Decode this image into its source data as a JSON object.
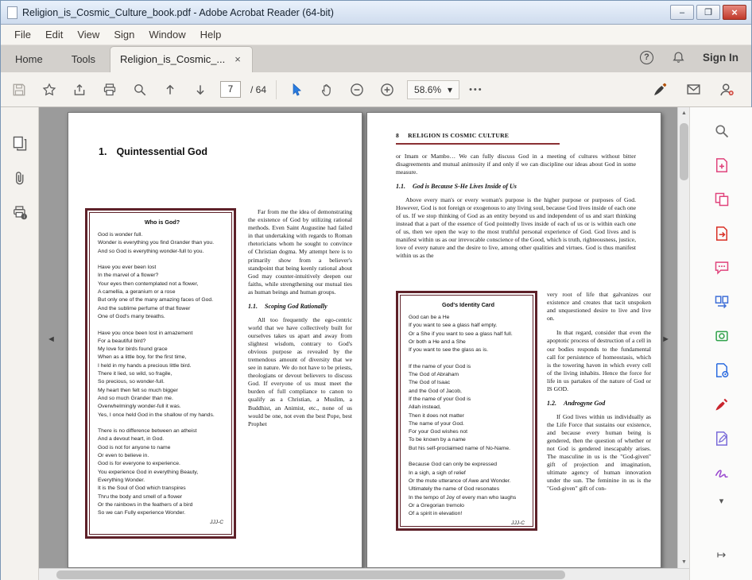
{
  "window": {
    "title": "Religion_is_Cosmic_Culture_book.pdf - Adobe Acrobat Reader (64-bit)"
  },
  "icons": {
    "minimize": "–",
    "maximize": "❐",
    "close": "×",
    "tab_close": "×",
    "help": "?",
    "caret_down": "▾",
    "ellipsis": "•••",
    "nav_left": "◄",
    "nav_right": "►",
    "scroll_up": "▲",
    "scroll_down": "▼",
    "pane_expand": "↦"
  },
  "colors": {
    "accent_blue": "#2a7de1",
    "close_button_red": "#c0392b",
    "poem_box_border": "#5e2129",
    "header_rule_maroon": "#8a3033",
    "document_background": "#9b9b9b"
  },
  "menu": {
    "items": [
      "File",
      "Edit",
      "View",
      "Sign",
      "Window",
      "Help"
    ]
  },
  "tabs": {
    "home": "Home",
    "tools": "Tools",
    "document": "Religion_is_Cosmic_...",
    "sign_in": "Sign In"
  },
  "toolbar": {
    "page_current": "7",
    "page_total": "/ 64",
    "zoom_level": "58.6%"
  },
  "left_page": {
    "heading_number": "1.",
    "heading_text": "Quintessential God",
    "poem_title": "Who is God?",
    "poem_lines": [
      "God is wonder full.",
      "Wonder is everything you find Grander than you.",
      "And so God is everything wonder-full to you.",
      "",
      "Have you ever been lost",
      "In the marvel of a flower?",
      "Your eyes then contemplated not a flower,",
      "A camellia, a geranium or a rose",
      "But only one of the many amazing faces of God.",
      "And the sublime perfume of that flower",
      "One of God's many breaths.",
      "",
      "Have you once been lost in amazement",
      "For a beautiful bird?",
      "My love for birds found grace",
      "When as a little boy, for the first time,",
      "I held in my hands a precious little bird.",
      "There it lied, so wild, so fragile,",
      "So precious, so wonder-full.",
      "My heart then felt so much bigger",
      "And so much Grander than me.",
      "Overwhelmingly wonder-full it was.",
      "Yes, I once held God in the shallow of my hands.",
      "",
      "There is no difference between an atheist",
      "And a devout heart, in God.",
      "God is not for anyone to name",
      "Or even to believe in.",
      "God is for everyone to experience.",
      "You experience God in everything Beauty,",
      "Everything Wonder.",
      "It is the Soul of God which transpires",
      "Thru the body and smell of a flower",
      "Or the rainbows in the feathers of a bird",
      "So we can Fully experience Wonder."
    ],
    "poem_signature": "JJJ-C",
    "col2_para1": "Far from me the idea of demonstrating the existence of God by utilizing rational methods. Even Saint Augustine had failed in that undertaking with regards to Roman rhetoricians whom he sought to convince of Christian dogma. My attempt here is to primarily show from a believer's standpoint that being keenly rational about God may counter-intuitively deepen our faiths, while strengthening our mutual ties as human beings and human groups.",
    "section_number": "1.1.",
    "section_title": "Scoping God Rationally",
    "col2_para2": "All too frequently the ego-centric world that we have collectively built for ourselves takes us apart and away from slightest wisdom, contrary to God's obvious purpose as revealed by the tremendous amount of diversity that we see in nature. We do not have to be priests, theologians or devout believers to discuss God. If everyone of us must meet the burden of full compliance to canon to qualify as a Christian, a Muslim, a Buddhist, an Animist, etc., none of us would be one, not even the best Pope, best Prophet"
  },
  "right_page": {
    "header_number": "8",
    "header_title": "RELIGION IS COSMIC CULTURE",
    "intro_para": "or Imam or Mambo… We can fully discuss God in a meeting of cultures without bitter disagreements and mutual animosity if and only if we can discipline our ideas about God in some measure.",
    "section1_number": "1.1.",
    "section1_title": "God is Because S-He Lives Inside of Us",
    "section1_para": "Above every man's or every woman's purpose is the higher purpose or purposes of God. However, God is not foreign or exogenous to any living soul, because God lives inside of each one of us. If we stop thinking of God as an entity beyond us and independent of us and start thinking instead that a part of the essence of God pointedly lives inside of each of us or is within each one of us, then we open the way to the most truthful personal experience of God. God lives and is manifest within us as our irrevocable conscience of the Good, which is truth, righteousness, justice, love of every nature and the desire to live, among other qualities and virtues. God is thus manifest within us as the",
    "card_title": "God's Identity Card",
    "card_lines": [
      "God can be a He",
      "If you want to see a glass half empty.",
      "Or a She if you want to see a glass half full.",
      "Or both a He and a She",
      "If you want to see the glass as is.",
      "",
      "If the name of your God is",
      "The God of Abraham",
      "The God of Isaac",
      "and the God of Jacob,",
      "If the name of your God is",
      "Allah instead,",
      "Then it does not matter",
      "The name of your God.",
      "For your God wishes not",
      "To be known by a name",
      "But his self-proclaimed name of No-Name.",
      "",
      "Because God can only be expressed",
      "In a sigh, a sigh of relief",
      "Or the mute utterance of Awe and Wonder.",
      "Ultimately the name of God resonates",
      "In the tempo of Joy of every man who laughs",
      "Or a Gregorian tremolo",
      "Of a spirit in elevation!"
    ],
    "card_signature": "JJJ-C",
    "col2_para1": "very root of life that galvanizes our existence and creates that tacit unspoken and unquestioned desire to live and live on.",
    "col2_para2": "In that regard, consider that even the apoptotic process of destruction of a cell in our bodies responds to the fundamental call for persistence of homeostasis, which is the towering haven in which every cell of the living inhabits. Hence the force for life in us partakes of the nature of God or IS GOD.",
    "section2_number": "1.2.",
    "section2_title": "Androgyne God",
    "section2_para": "If God lives within us individually as the Life Force that sustains our existence, and because every human being is gendered, then the question of whether or not God is gendered inescapably arises. The masculine in us is the \"God-given\" gift of projection and imagination, ultimate agency of human innovation under the sun. The feminine in us is the \"God-given\" gift of con-"
  }
}
